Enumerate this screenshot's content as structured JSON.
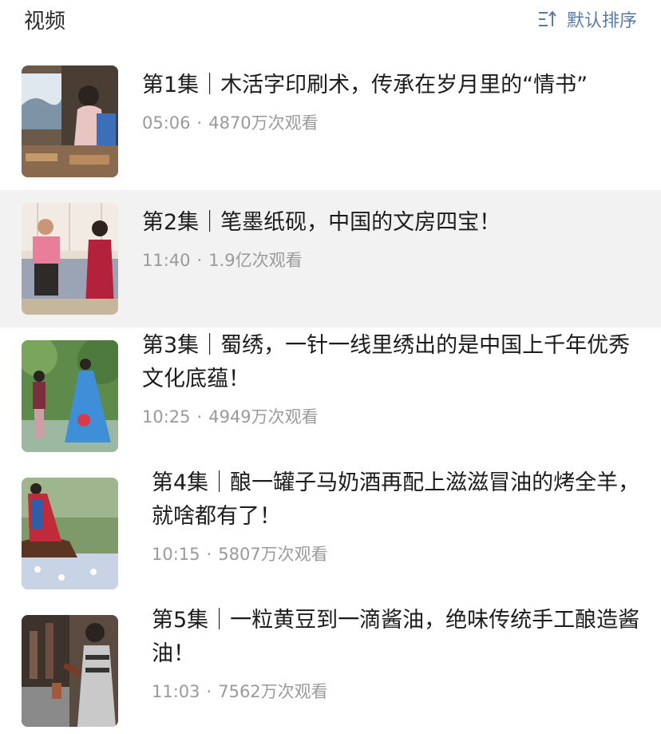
{
  "header": {
    "title": "视频",
    "sort_label": "默认排序",
    "sort_icon": "sort-icon"
  },
  "videos": [
    {
      "title": "第1集｜木活字印刷术，传承在岁月里的“情书”",
      "duration": "05:06",
      "views": "4870万次观看"
    },
    {
      "title": "第2集｜笔墨纸砚，中国的文房四宝！",
      "duration": "11:40",
      "views": "1.9亿次观看"
    },
    {
      "title": "第3集｜蜀绣，一针一线里绣出的是中国上千年优秀文化底蕴！",
      "duration": "10:25",
      "views": "4949万次观看"
    },
    {
      "title": "第4集｜酿一罐子马奶酒再配上滋滋冒油的烤全羊，就啥都有了！",
      "duration": "10:15",
      "views": "5807万次观看"
    },
    {
      "title": "第5集｜一粒黄豆到一滴酱油，绝味传统手工酿造酱油！",
      "duration": "11:03",
      "views": "7562万次观看"
    }
  ],
  "meta_separator": "·"
}
